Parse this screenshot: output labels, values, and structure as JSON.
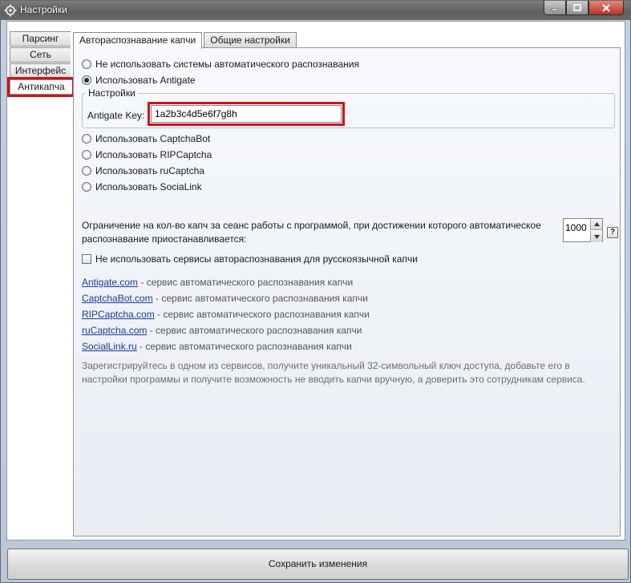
{
  "window": {
    "title": "Настройки"
  },
  "sidebar": {
    "items": [
      {
        "label": "Парсинг"
      },
      {
        "label": "Сеть"
      },
      {
        "label": "Интерфейс"
      },
      {
        "label": "Антикапча"
      }
    ]
  },
  "tabs": [
    {
      "label": "Автораспознавание капчи"
    },
    {
      "label": "Общие настройки"
    }
  ],
  "options": {
    "no_auto": "Не использовать системы автоматического распознавания",
    "antigate": "Использовать Antigate",
    "captchabot": "Использовать CaptchaBot",
    "ripcaptcha": "Использовать RIPCaptcha",
    "rucaptcha": "Использовать ruCaptcha",
    "socialink": "Использовать SociaLink"
  },
  "settings_group": {
    "legend": "Настройки",
    "key_label": "Antigate Key:",
    "key_value": "1a2b3c4d5e6f7g8h"
  },
  "limit": {
    "text_line1": "Ограничение на кол-во капч за сеанс работы с программой, при достижении которого автоматическое",
    "text_line2": "распознавание приостанавливается:",
    "value": "1000",
    "help": "?"
  },
  "russian_checkbox": "Не использовать сервисы автораспознавания для русскоязычной капчи",
  "links": [
    {
      "name": "Antigate.com",
      "desc": " - сервис автоматического распознавания капчи"
    },
    {
      "name": "CaptchaBot.com",
      "desc": " - сервис автоматического распознавания капчи"
    },
    {
      "name": "RIPCaptcha.com",
      "desc": " - сервис автоматического распознавания капчи"
    },
    {
      "name": "ruCaptcha.com",
      "desc": " - сервис автоматического распознавания капчи"
    },
    {
      "name": "SocialLink.ru",
      "desc": " - сервис автоматического распознавания капчи"
    }
  ],
  "note": {
    "line1": "Зарегистрируйтесь в одном из сервисов, получите уникальный 32-символьный ключ доступа, добавьте его в",
    "line2": "настройки программы и получите возможность не вводить капчи вручную, а доверить это сотрудникам сервиса."
  },
  "save_button": "Сохранить изменения",
  "colors": {
    "highlight": "#cc1414",
    "link": "#1a3d8f"
  }
}
